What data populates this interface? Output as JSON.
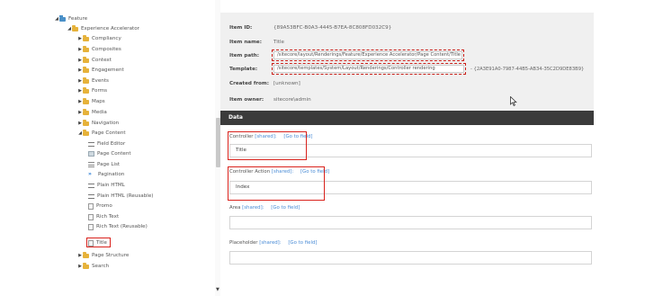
{
  "tree": {
    "items": [
      {
        "label": "Feature",
        "arrow": "◢",
        "icon": "feature-folder-icon"
      },
      {
        "label": "Experience Accelerator",
        "arrow": "◢",
        "icon": "folder-icon"
      },
      {
        "label": "Compliancy",
        "arrow": "▶",
        "icon": "folder-icon"
      },
      {
        "label": "Composites",
        "arrow": "▶",
        "icon": "folder-icon"
      },
      {
        "label": "Context",
        "arrow": "▶",
        "icon": "folder-icon"
      },
      {
        "label": "Engagement",
        "arrow": "▶",
        "icon": "folder-icon"
      },
      {
        "label": "Events",
        "arrow": "▶",
        "icon": "folder-icon"
      },
      {
        "label": "Forms",
        "arrow": "▶",
        "icon": "folder-icon"
      },
      {
        "label": "Maps",
        "arrow": "▶",
        "icon": "folder-icon"
      },
      {
        "label": "Media",
        "arrow": "▶",
        "icon": "folder-icon"
      },
      {
        "label": "Navigation",
        "arrow": "▶",
        "icon": "folder-icon"
      },
      {
        "label": "Page Content",
        "arrow": "◢",
        "icon": "folder-icon"
      },
      {
        "label": "Field Editor",
        "arrow": "",
        "icon": "field-editor-icon"
      },
      {
        "label": "Page Content",
        "arrow": "",
        "icon": "page-content-icon"
      },
      {
        "label": "Page List",
        "arrow": "",
        "icon": "page-list-icon"
      },
      {
        "label": "Pagination",
        "arrow": "",
        "icon": "pagination-icon"
      },
      {
        "label": "Plain HTML",
        "arrow": "",
        "icon": "plain-html-icon"
      },
      {
        "label": "Plain HTML (Reusable)",
        "arrow": "",
        "icon": "plain-html-icon"
      },
      {
        "label": "Promo",
        "arrow": "",
        "icon": "promo-icon"
      },
      {
        "label": "Rich Text",
        "arrow": "",
        "icon": "rich-text-icon"
      },
      {
        "label": "Rich Text (Reusable)",
        "arrow": "",
        "icon": "rich-text-icon"
      },
      {
        "label": "Title",
        "arrow": "",
        "icon": "title-icon"
      },
      {
        "label": "Page Structure",
        "arrow": "▶",
        "icon": "folder-icon"
      },
      {
        "label": "Search",
        "arrow": "▶",
        "icon": "folder-icon"
      }
    ]
  },
  "quickinfo": {
    "item_id_label": "Item ID:",
    "item_id_value": "{89A53BFC-B0A3-4445-B7EA-8C808FD032C9}",
    "item_name_label": "Item name:",
    "item_name_value": "Title",
    "item_path_label": "Item path:",
    "item_path_value": "/sitecore/layout/Renderings/Feature/Experience Accelerator/Page Content/Title",
    "template_label": "Template:",
    "template_value": "/sitecore/templates/System/Layout/Renderings/Controller rendering",
    "template_id": "- {2A3E91A0-7987-44B5-AB34-35C2D9DE83B9}",
    "created_from_label": "Created from:",
    "created_from_value": "[unknown]",
    "item_owner_label": "Item owner:",
    "item_owner_value": "sitecore\\admin"
  },
  "data_section": {
    "header": "Data",
    "fields": [
      {
        "label": "Controller",
        "meta": "[shared]:",
        "goto": "[Go to field]",
        "value": "Title"
      },
      {
        "label": "Controller Action",
        "meta": "[shared]:",
        "goto": "[Go to field]",
        "value": "Index"
      },
      {
        "label": "Area",
        "meta": "[shared]:",
        "goto": "[Go to field]",
        "value": ""
      },
      {
        "label": "Placeholder",
        "meta": "[shared]:",
        "goto": "[Go to field]",
        "value": ""
      }
    ]
  },
  "colors": {
    "section_header_bg": "#3b3b3b",
    "highlight_red": "#d9221c",
    "link_blue": "#4a8cd6",
    "folder_yellow": "#e6b23a"
  }
}
